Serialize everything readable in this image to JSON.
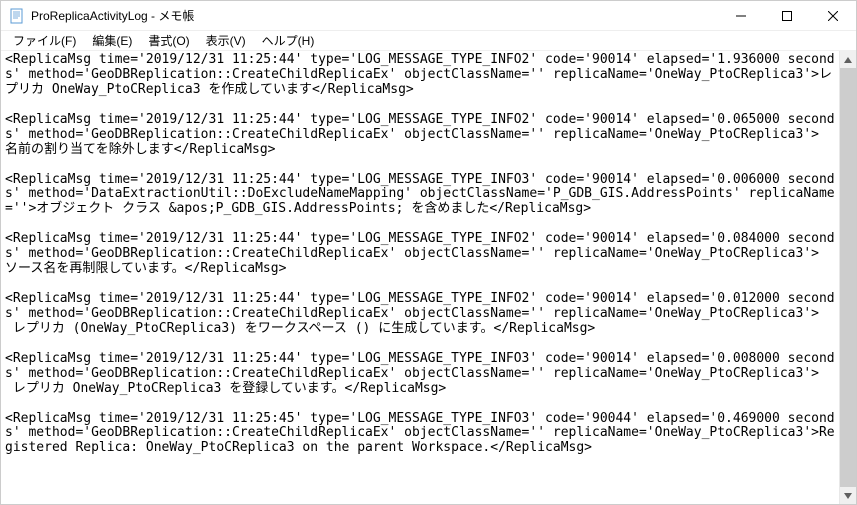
{
  "window": {
    "title": "ProReplicaActivityLog - メモ帳"
  },
  "menu": {
    "file": "ファイル(F)",
    "edit": "編集(E)",
    "format": "書式(O)",
    "view": "表示(V)",
    "help": "ヘルプ(H)"
  },
  "content": {
    "text": "<ReplicaMsg time='2019/12/31 11:25:44' type='LOG_MESSAGE_TYPE_INFO2' code='90014' elapsed='1.936000 seconds' method='GeoDBReplication::CreateChildReplicaEx' objectClassName='' replicaName='OneWay_PtoCReplica3'>レプリカ OneWay_PtoCReplica3 を作成しています</ReplicaMsg>\n\n<ReplicaMsg time='2019/12/31 11:25:44' type='LOG_MESSAGE_TYPE_INFO2' code='90014' elapsed='0.065000 seconds' method='GeoDBReplication::CreateChildReplicaEx' objectClassName='' replicaName='OneWay_PtoCReplica3'>\n名前の割り当てを除外します</ReplicaMsg>\n\n<ReplicaMsg time='2019/12/31 11:25:44' type='LOG_MESSAGE_TYPE_INFO3' code='90014' elapsed='0.006000 seconds' method='DataExtractionUtil::DoExcludeNameMapping' objectClassName='P_GDB_GIS.AddressPoints' replicaName=''>オブジェクト クラス &apos;P_GDB_GIS.AddressPoints; を含めました</ReplicaMsg>\n\n<ReplicaMsg time='2019/12/31 11:25:44' type='LOG_MESSAGE_TYPE_INFO2' code='90014' elapsed='0.084000 seconds' method='GeoDBReplication::CreateChildReplicaEx' objectClassName='' replicaName='OneWay_PtoCReplica3'>\nソース名を再制限しています。</ReplicaMsg>\n\n<ReplicaMsg time='2019/12/31 11:25:44' type='LOG_MESSAGE_TYPE_INFO2' code='90014' elapsed='0.012000 seconds' method='GeoDBReplication::CreateChildReplicaEx' objectClassName='' replicaName='OneWay_PtoCReplica3'>\n レプリカ (OneWay_PtoCReplica3) をワークスペース () に生成しています。</ReplicaMsg>\n\n<ReplicaMsg time='2019/12/31 11:25:44' type='LOG_MESSAGE_TYPE_INFO3' code='90014' elapsed='0.008000 seconds' method='GeoDBReplication::CreateChildReplicaEx' objectClassName='' replicaName='OneWay_PtoCReplica3'>\n レプリカ OneWay_PtoCReplica3 を登録しています。</ReplicaMsg>\n\n<ReplicaMsg time='2019/12/31 11:25:45' type='LOG_MESSAGE_TYPE_INFO3' code='90044' elapsed='0.469000 seconds' method='GeoDBReplication::CreateChildReplicaEx' objectClassName='' replicaName='OneWay_PtoCReplica3'>Registered Replica: OneWay_PtoCReplica3 on the parent Workspace.</ReplicaMsg>\n"
  }
}
